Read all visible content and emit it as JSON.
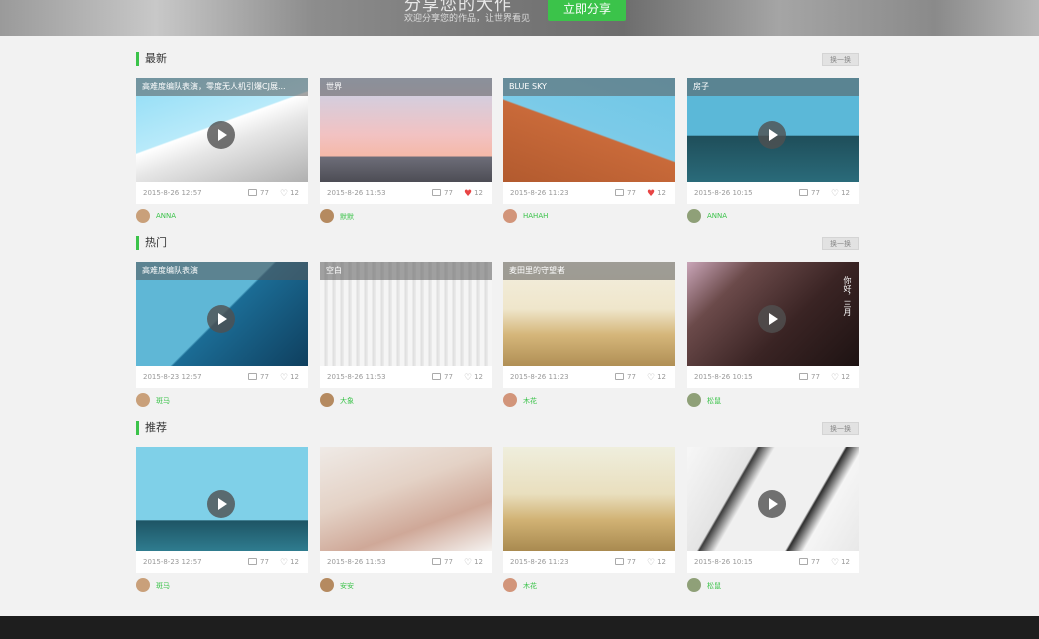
{
  "banner": {
    "title": "分享您的大作",
    "subtitle": "欢迎分享您的作品，让世界看见",
    "share_button": "立即分享"
  },
  "sections": [
    {
      "title": "最新",
      "swap_label": "换一换",
      "cards": [
        {
          "caption": "高难度编队表演，零度无人机引爆CJ展...",
          "date": "2015-8-26  12:57",
          "comments": "77",
          "likes": "12",
          "liked": false,
          "user": "ANNA",
          "video": true
        },
        {
          "caption": "世界",
          "date": "2015-8-26  11:53",
          "comments": "77",
          "likes": "12",
          "liked": true,
          "user": "默默",
          "video": false
        },
        {
          "caption": "BLUE SKY",
          "date": "2015-8-26  11:23",
          "comments": "77",
          "likes": "12",
          "liked": true,
          "user": "HAHAH",
          "video": false
        },
        {
          "caption": "房子",
          "date": "2015-8-26  10:15",
          "comments": "77",
          "likes": "12",
          "liked": false,
          "user": "ANNA",
          "video": true
        }
      ]
    },
    {
      "title": "热门",
      "swap_label": "换一换",
      "cards": [
        {
          "caption": "高难度编队表演",
          "date": "2015-8-23  12:57",
          "comments": "77",
          "likes": "12",
          "liked": false,
          "user": "斑马",
          "video": true
        },
        {
          "caption": "空白",
          "date": "2015-8-26  11:53",
          "comments": "77",
          "likes": "12",
          "liked": false,
          "user": "大象",
          "video": false
        },
        {
          "caption": "麦田里的守望者",
          "date": "2015-8-26  11:23",
          "comments": "77",
          "likes": "12",
          "liked": false,
          "user": "木花",
          "video": false
        },
        {
          "caption": "",
          "date": "2015-8-26  10:15",
          "comments": "77",
          "likes": "12",
          "liked": false,
          "user": "松鼠",
          "video": true,
          "overlay_text": "你好，三月"
        }
      ]
    },
    {
      "title": "推荐",
      "swap_label": "换一换",
      "cards": [
        {
          "caption": "",
          "date": "2015-8-23  12:57",
          "comments": "77",
          "likes": "12",
          "liked": false,
          "user": "斑马",
          "video": true
        },
        {
          "caption": "",
          "date": "2015-8-26  11:53",
          "comments": "77",
          "likes": "12",
          "liked": false,
          "user": "安安",
          "video": false
        },
        {
          "caption": "",
          "date": "2015-8-26  11:23",
          "comments": "77",
          "likes": "12",
          "liked": false,
          "user": "木花",
          "video": false
        },
        {
          "caption": "",
          "date": "2015-8-26  10:15",
          "comments": "77",
          "likes": "12",
          "liked": false,
          "user": "松鼠",
          "video": true
        }
      ]
    }
  ]
}
